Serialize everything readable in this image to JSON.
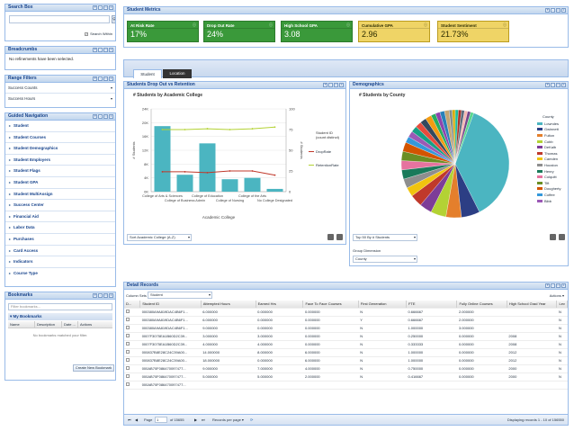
{
  "search_box": {
    "title": "Search Box",
    "search_within": "Search Within"
  },
  "breadcrumbs": {
    "title": "Breadcrumbs",
    "text": "No refinements have been selected."
  },
  "range_filters": {
    "title": "Range Filters",
    "items": [
      "Success Counts",
      "Success Hours"
    ]
  },
  "guided_nav": {
    "title": "Guided Navigation",
    "items": [
      "Student",
      "Student Courses",
      "Student Demographics",
      "Student Employers",
      "Student Flags",
      "Student GPA",
      "Student MultiAssign",
      "Success Center",
      "Financial Aid",
      "Labor Data",
      "Purchases",
      "Card Access",
      "Indicators",
      "Course Type"
    ]
  },
  "bookmarks": {
    "title": "Bookmarks",
    "filter_placeholder": "Filter bookmarks...",
    "my_bookmarks": "My Bookmarks",
    "columns": [
      "Name",
      "Description",
      "Date ...",
      "Actions"
    ],
    "empty": "No bookmarks matched your filter.",
    "create_button": "Create New Bookmark"
  },
  "student_metrics": {
    "title": "Student Metrics",
    "kpis": [
      {
        "label": "At Risk Rate",
        "value": "17%",
        "color": "#3a993a"
      },
      {
        "label": "Drop Out Rate",
        "value": "24%",
        "color": "#3a993a"
      },
      {
        "label": "High School GPA",
        "value": "3.08",
        "color": "#3a993a"
      },
      {
        "label": "Cumulative GPA",
        "value": "2.96",
        "color": "#efd466"
      },
      {
        "label": "Student Sentiment",
        "value": "21.73%",
        "color": "#efd466"
      }
    ]
  },
  "tabs": [
    "Student",
    "Location"
  ],
  "dropout_panel": {
    "title": "Students Drop Out vs Retention",
    "sort_value": "Sort Academic College (A-Z)"
  },
  "demographics_panel": {
    "title": "Demographics",
    "top_value": "Top 50 By # Students",
    "group_dimension_label": "Group Dimension",
    "group_dimension_value": "County"
  },
  "chart_data": [
    {
      "type": "bar",
      "title": "# Students by Academic College",
      "xlabel": "Academic College",
      "ylabel": "# Students",
      "y2label": "# Students",
      "categories": [
        "College of Arts & Sciences",
        "College of Business Admin",
        "College of Education",
        "College of Nursing",
        "College of the Arts",
        "No College Designated"
      ],
      "series": [
        {
          "name": "Student ID (count distinct)",
          "kind": "bar",
          "axis": "left",
          "values": [
            19000,
            4900,
            14000,
            3600,
            4000,
            800
          ],
          "color": "#4bb5c1"
        },
        {
          "name": "DropRate",
          "kind": "line",
          "axis": "right",
          "values": [
            24,
            24,
            23,
            25,
            25,
            20
          ],
          "color": "#c0392b"
        },
        {
          "name": "RetentionRate",
          "kind": "line",
          "axis": "right",
          "values": [
            75,
            75,
            76,
            75,
            76,
            78
          ],
          "color": "#b3d234"
        }
      ],
      "ylim": [
        0,
        24000
      ],
      "y2lim": [
        0,
        100
      ],
      "y_ticks": [
        "0K",
        "4K",
        "8K",
        "12K",
        "16K",
        "20K",
        "24K"
      ],
      "y2_ticks": [
        "0",
        "25",
        "50",
        "75",
        "100"
      ],
      "legend_title": "Student ID (count distinct)",
      "legend_position": "right"
    },
    {
      "type": "pie",
      "title": "# Students by County",
      "legend_title": "County",
      "legend_position": "right",
      "labels": [
        "Lowndes",
        "Gwinnett",
        "Fulton",
        "Cobb",
        "DeKalb",
        "Thomas",
        "Camden",
        "Houston",
        "Henry",
        "Colquitt",
        "Tift",
        "Dougherty",
        "Coffee",
        "Bibb"
      ],
      "values": [
        40,
        6,
        5,
        5,
        4,
        4,
        3,
        3,
        3,
        3,
        3,
        3,
        2,
        2,
        2,
        2,
        2,
        2,
        1.5,
        1.5,
        1.5,
        1.5,
        1,
        1,
        1,
        1,
        1,
        1,
        1,
        1
      ],
      "colors": [
        "#4bb5c1",
        "#2c3e84",
        "#e47f2c",
        "#b3d234",
        "#7d3c98",
        "#c0392b",
        "#f1c40f",
        "#8e8e8e",
        "#1a7a5a",
        "#e6739f",
        "#6b8e23",
        "#d35400",
        "#3498db",
        "#9b59b6",
        "#16a085",
        "#e74c3c",
        "#34495e",
        "#f39c12",
        "#27ae60",
        "#8e44ad",
        "#2980b9",
        "#c5a572",
        "#7f8c8d",
        "#d4ac0d",
        "#1abc9c",
        "#a93226",
        "#5d6d7e",
        "#f5b7b1",
        "#76448a",
        "#58d68d"
      ]
    }
  ],
  "detail_records": {
    "title": "Detail Records",
    "column_sets_label": "Column Sets",
    "column_sets_value": "Student",
    "actions_label": "Actions",
    "columns": [
      "D...",
      "Student ID",
      "Attempted Hours",
      "Earned Hrs",
      "Face To Face Courses",
      "First Generation",
      "FTE",
      "Fully Online Courses",
      "High School Grad Year",
      "Lev"
    ],
    "rows": [
      [
        "",
        "000380A9A819DAC4B6F1...",
        "6.000000",
        "0.000000",
        "0.000000",
        "N",
        "0.666667",
        "2.000000",
        "",
        "N"
      ],
      [
        "",
        "000380A9A819DAC4B6F1...",
        "6.000000",
        "0.000000",
        "0.000000",
        "Y",
        "0.666667",
        "2.000000",
        "",
        "N"
      ],
      [
        "",
        "000380A9A819DAC4B6F1...",
        "9.000000",
        "0.000000",
        "0.000000",
        "N",
        "1.000000",
        "3.000000",
        "",
        "N"
      ],
      [
        "",
        "0007F3075EA1B60D2C39...",
        "3.000000",
        "3.000000",
        "0.000000",
        "N",
        "0.250000",
        "0.000000",
        "2008",
        "N"
      ],
      [
        "",
        "0007F3075EA1B60D2C39...",
        "4.000000",
        "4.000000",
        "0.000000",
        "N",
        "0.333333",
        "0.000000",
        "2008",
        "N"
      ],
      [
        "",
        "000837B8E28C24C39A00...",
        "14.000000",
        "8.000000",
        "6.000000",
        "N",
        "1.000000",
        "0.000000",
        "2012",
        "N"
      ],
      [
        "",
        "000837B8E28C24C39A00...",
        "18.000000",
        "0.000000",
        "6.000000",
        "N",
        "1.000000",
        "0.000000",
        "2012",
        "N"
      ],
      [
        "",
        "000AB70F086470097477...",
        "9.000000",
        "7.000000",
        "4.000000",
        "N",
        "0.750000",
        "0.000000",
        "2000",
        "N"
      ],
      [
        "",
        "000AB70F086470097477...",
        "5.000000",
        "5.000000",
        "2.000000",
        "N",
        "0.416667",
        "0.000000",
        "2000",
        "N"
      ],
      [
        "",
        "000AB70F086470097477...",
        "",
        "",
        "",
        "",
        "",
        "",
        "",
        ""
      ]
    ]
  },
  "pager": {
    "page_label": "Page",
    "page_value": "1",
    "of_label": "of 15655",
    "records_per_page": "Records per page",
    "summary": "Displaying records 1 - 10 of 156550"
  }
}
